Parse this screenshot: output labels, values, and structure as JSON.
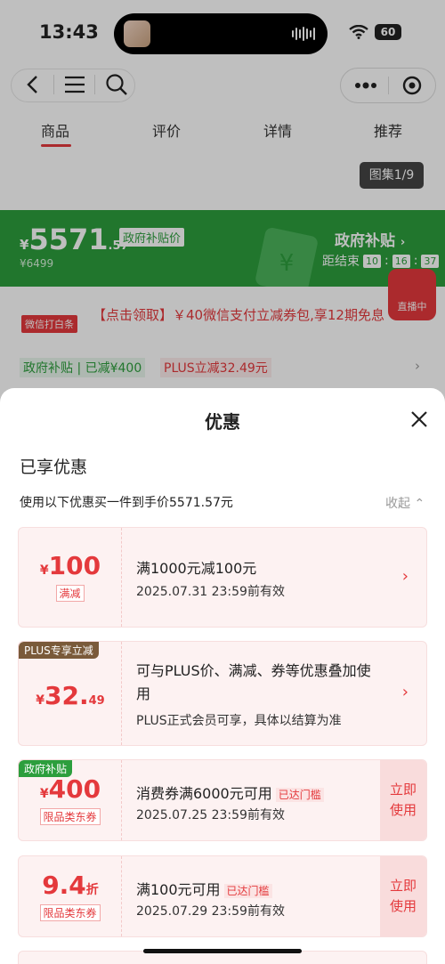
{
  "status_bar": {
    "time": "13:43",
    "battery": "60"
  },
  "tabs": [
    "商品",
    "评价",
    "详情",
    "推荐"
  ],
  "album": "图集1/9",
  "price_band": {
    "currency": "¥",
    "price_int": "5571",
    "price_dec": ".57",
    "price_tag": "政府补贴价",
    "original_price": "¥6499",
    "gov_title": "政府补贴",
    "countdown_label": "距结束",
    "countdown": [
      "10",
      "16",
      "37"
    ]
  },
  "live_label": "直播中",
  "promo": {
    "tag": "微信打白条",
    "text": "【点击领取】￥40微信支付立减券包,享12期免息",
    "chip_gov": "政府补贴 | 已减¥400",
    "chip_plus": "PLUS立减32.49元"
  },
  "sheet": {
    "title": "优惠",
    "section": "已享优惠",
    "subline": "使用以下优惠买一件到手价5571.57元",
    "collapse": "收起"
  },
  "coupons": [
    {
      "corner": "",
      "currency": "¥",
      "amount": "100",
      "decimal": "",
      "suffix": "",
      "sub": "满减",
      "line1": "满1000元减100元",
      "badge": "",
      "line2": "2025.07.31 23:59前有效",
      "action": ""
    },
    {
      "corner": "PLUS专享立减",
      "currency": "¥",
      "amount": "32.",
      "decimal": "49",
      "suffix": "",
      "sub": "",
      "line1": "可与PLUS价、满减、券等优惠叠加使用",
      "badge": "",
      "line2": "PLUS正式会员可享，具体以结算为准",
      "action": ""
    },
    {
      "corner": "政府补贴",
      "currency": "¥",
      "amount": "400",
      "decimal": "",
      "suffix": "",
      "sub": "限品类东券",
      "line1": "消费券满6000元可用",
      "badge": "已达门槛",
      "line2": "2025.07.25 23:59前有效",
      "action": "立即使用"
    },
    {
      "corner": "",
      "currency": "",
      "amount": "9.4",
      "decimal": "",
      "suffix": "折",
      "sub": "限品类东券",
      "line1": "满100元可用",
      "badge": "已达门槛",
      "line2": "2025.07.29 23:59前有效",
      "action": "立即使用"
    }
  ],
  "colors": {
    "brand_red": "#e4393c",
    "gov_green": "#2c9e3d",
    "plus_brown": "#7a5a3a"
  }
}
